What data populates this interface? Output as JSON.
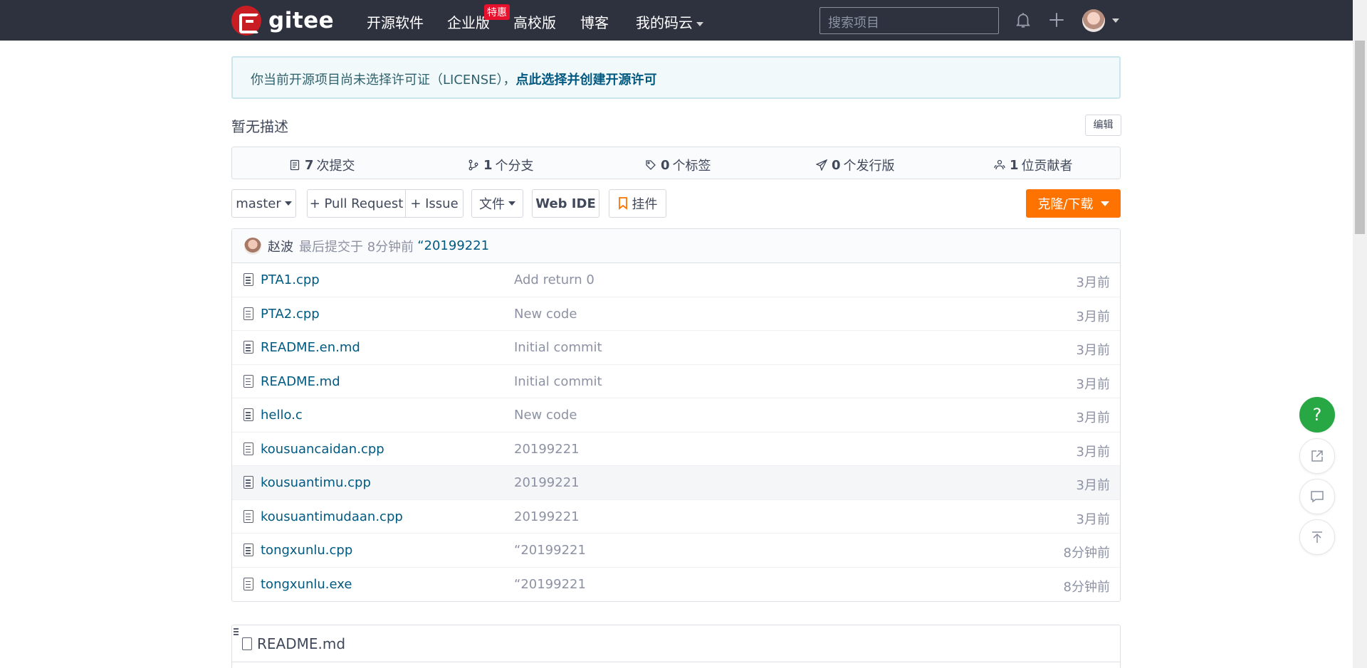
{
  "topbar": {
    "logo_text": "gitee",
    "nav": [
      "开源软件",
      "企业版",
      "高校版",
      "博客",
      "我的码云"
    ],
    "badge": "特惠",
    "search_placeholder": "搜索项目"
  },
  "notice": {
    "text": "你当前开源项目尚未选择许可证（LICENSE），",
    "link": "点此选择并创建开源许可"
  },
  "description": "暂无描述",
  "edit_label": "编辑",
  "stats": [
    {
      "count": "7",
      "label": "次提交"
    },
    {
      "count": "1",
      "label": "个分支"
    },
    {
      "count": "0",
      "label": "个标签"
    },
    {
      "count": "0",
      "label": "个发行版"
    },
    {
      "count": "1",
      "label": "位贡献者"
    }
  ],
  "toolbar": {
    "branch": "master",
    "pull_request": "+ Pull Request",
    "issue": "+ Issue",
    "files": "文件",
    "web_ide": "Web IDE",
    "widget": "挂件",
    "clone": "克隆/下载"
  },
  "last_commit": {
    "author": "赵波",
    "meta": "最后提交于 8分钟前",
    "message": "“20199221"
  },
  "files": [
    {
      "name": "PTA1.cpp",
      "commit": "Add return 0",
      "time": "3月前"
    },
    {
      "name": "PTA2.cpp",
      "commit": "New code",
      "time": "3月前"
    },
    {
      "name": "README.en.md",
      "commit": "Initial commit",
      "time": "3月前"
    },
    {
      "name": "README.md",
      "commit": "Initial commit",
      "time": "3月前"
    },
    {
      "name": "hello.c",
      "commit": "New code",
      "time": "3月前"
    },
    {
      "name": "kousuancaidan.cpp",
      "commit": "20199221",
      "time": "3月前"
    },
    {
      "name": "kousuantimu.cpp",
      "commit": "20199221",
      "time": "3月前"
    },
    {
      "name": "kousuantimudaan.cpp",
      "commit": "20199221",
      "time": "3月前"
    },
    {
      "name": "tongxunlu.cpp",
      "commit": "“20199221",
      "time": "8分钟前"
    },
    {
      "name": "tongxunlu.exe",
      "commit": "“20199221",
      "time": "8分钟前"
    }
  ],
  "readme_title": "README.md",
  "float": {
    "help": "?"
  }
}
